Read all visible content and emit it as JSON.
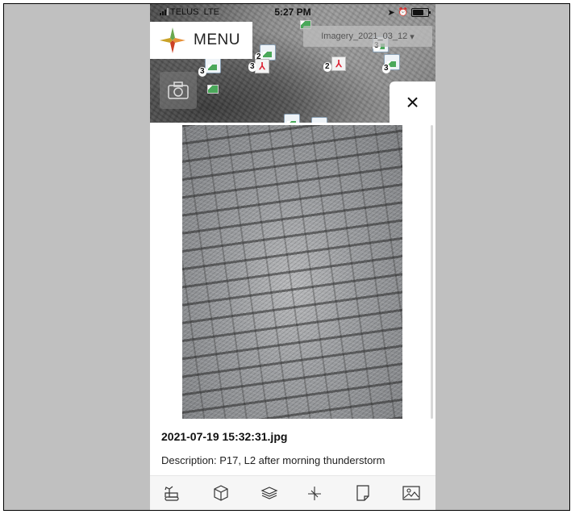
{
  "status_bar": {
    "carrier": "TELUS",
    "network": "LTE",
    "time": "5:27 PM"
  },
  "map": {
    "menu_label": "MENU",
    "imagery_label": "Imagery_2021_03_12",
    "imagery_chevron": "▾",
    "markers": [
      {
        "count": "3"
      },
      {
        "count": "2"
      },
      {
        "count": "3"
      },
      {
        "count": "2"
      },
      {
        "count": "3"
      },
      {
        "count": "3"
      }
    ]
  },
  "photo_card": {
    "close_icon": "×",
    "filename": "2021-07-19 15:32:31.jpg",
    "description": "Description: P17, L2 after morning thunderstorm"
  },
  "toolbar": {
    "items": [
      {
        "icon": "excavator-icon"
      },
      {
        "icon": "cube-icon"
      },
      {
        "icon": "layers-icon"
      },
      {
        "icon": "measure-icon"
      },
      {
        "icon": "note-icon"
      },
      {
        "icon": "image-icon"
      }
    ]
  }
}
